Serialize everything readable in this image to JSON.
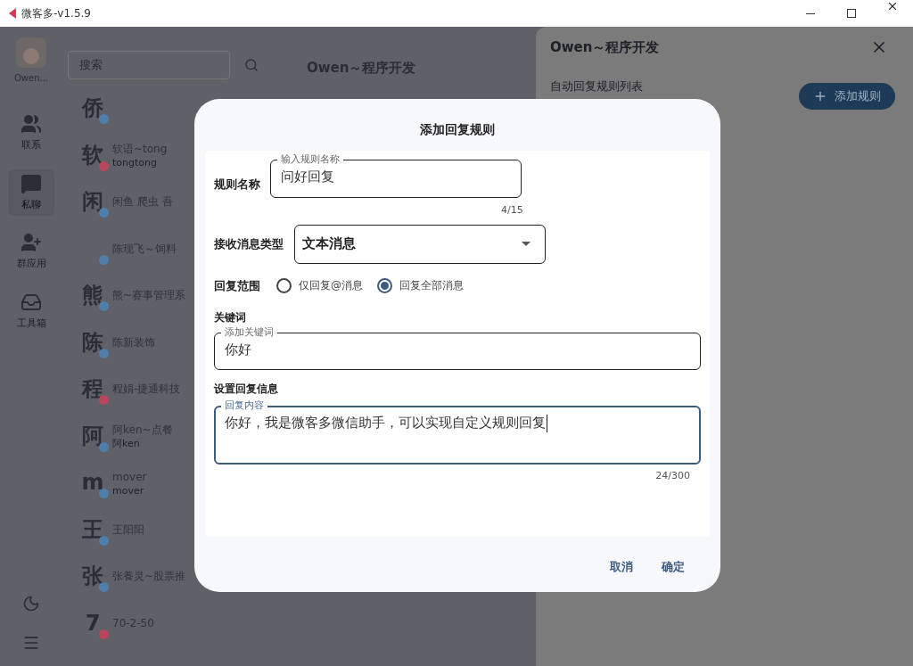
{
  "window": {
    "title": "微客多-v1.5.9"
  },
  "user": {
    "name": "Owen..."
  },
  "nav": [
    {
      "kind": "contacts",
      "label": "联系",
      "selected": false
    },
    {
      "kind": "chat",
      "label": "私聊",
      "selected": true
    },
    {
      "kind": "group",
      "label": "群应用",
      "selected": false
    },
    {
      "kind": "tools",
      "label": "工具箱",
      "selected": false
    }
  ],
  "search": {
    "placeholder": "搜索"
  },
  "contacts": [
    {
      "avatar": "侨",
      "color": "#4f7fa8"
    },
    {
      "avatar": "软",
      "name": "软语~tong",
      "sub": "tongtong",
      "color": "#b8475c"
    },
    {
      "avatar": "闲",
      "name": "闲鱼 爬虫 吾",
      "color": "#4f7fa8"
    },
    {
      "name": "陈现飞～饲料",
      "color": "#4f7fa8"
    },
    {
      "avatar": "熊",
      "name": "熊~赛事管理系",
      "color": "#4f7fa8"
    },
    {
      "avatar": "陈",
      "name": "陈新装饰",
      "color": "#4f7fa8"
    },
    {
      "avatar": "程",
      "name": "程娟-捷通科技",
      "color": "#b8475c"
    },
    {
      "avatar": "阿",
      "name": "阿ken~点餐",
      "sub": "阿ken",
      "color": "#4f7fa8"
    },
    {
      "avatar": "m",
      "name": "mover",
      "sub": "mover",
      "color": "#4f7fa8"
    },
    {
      "avatar": "王",
      "name": "王阳阳",
      "color": "#4f7fa8"
    },
    {
      "avatar": "张",
      "name": "张養灵~股票推",
      "color": "#4f7fa8"
    },
    {
      "avatar": "7",
      "name": "70-2-50",
      "color": "#b8475c"
    }
  ],
  "chat": {
    "title": "Owen～程序开发"
  },
  "panel": {
    "title": "Owen～程序开发",
    "heading": "自动回复规则列表",
    "add_button": "添加规则"
  },
  "dialog": {
    "title": "添加回复规则",
    "name_row": {
      "label": "规则名称",
      "field_label": "输入规则名称",
      "value": "问好回复",
      "counter": "4/15"
    },
    "type_row": {
      "label": "接收消息类型",
      "value": "文本消息"
    },
    "scope_row": {
      "label": "回复范围",
      "options": [
        {
          "label": "仅回复@消息",
          "selected": false
        },
        {
          "label": "回复全部消息",
          "selected": true
        }
      ]
    },
    "keyword": {
      "heading": "关键词",
      "field_label": "添加关键词",
      "value": "你好"
    },
    "reply": {
      "heading": "设置回复信息",
      "field_label": "回复内容",
      "value": "你好，我是微客多微信助手，可以实现自定义规则回复",
      "counter": "24/300",
      "focused": true
    },
    "buttons": [
      "取消",
      "确定"
    ]
  }
}
